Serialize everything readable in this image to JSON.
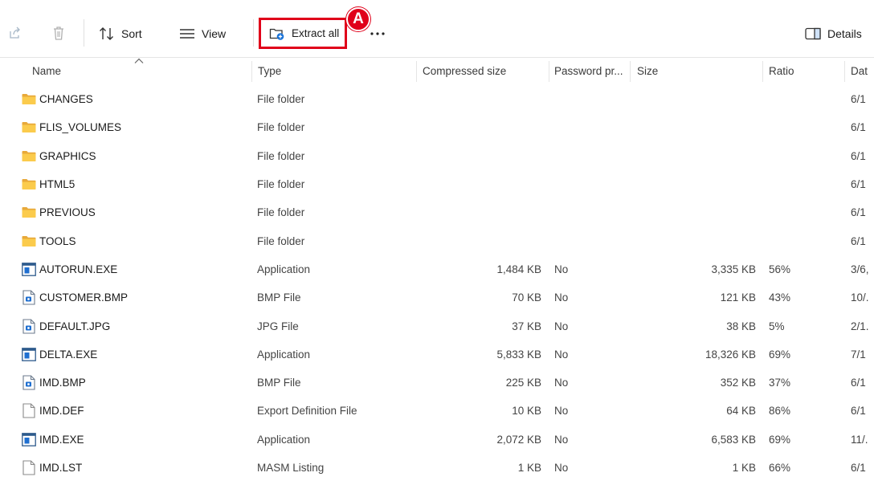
{
  "toolbar": {
    "share_icon": "share-icon",
    "delete_icon": "trash-icon",
    "sort_label": "Sort",
    "view_label": "View",
    "extract_label": "Extract all",
    "more_label": "…",
    "details_label": "Details",
    "marker_label": "A",
    "highlight_color": "#e0001a"
  },
  "columns": {
    "name": "Name",
    "type": "Type",
    "compressed": "Compressed size",
    "password": "Password pr...",
    "size": "Size",
    "ratio": "Ratio",
    "date": "Dat"
  },
  "rows": [
    {
      "icon": "folder-icon",
      "name": "CHANGES",
      "type": "File folder",
      "compressed": "",
      "password": "",
      "size": "",
      "ratio": "",
      "date": "6/1"
    },
    {
      "icon": "folder-icon",
      "name": "FLIS_VOLUMES",
      "type": "File folder",
      "compressed": "",
      "password": "",
      "size": "",
      "ratio": "",
      "date": "6/1"
    },
    {
      "icon": "folder-icon",
      "name": "GRAPHICS",
      "type": "File folder",
      "compressed": "",
      "password": "",
      "size": "",
      "ratio": "",
      "date": "6/1"
    },
    {
      "icon": "folder-icon",
      "name": "HTML5",
      "type": "File folder",
      "compressed": "",
      "password": "",
      "size": "",
      "ratio": "",
      "date": "6/1"
    },
    {
      "icon": "folder-icon",
      "name": "PREVIOUS",
      "type": "File folder",
      "compressed": "",
      "password": "",
      "size": "",
      "ratio": "",
      "date": "6/1"
    },
    {
      "icon": "folder-icon",
      "name": "TOOLS",
      "type": "File folder",
      "compressed": "",
      "password": "",
      "size": "",
      "ratio": "",
      "date": "6/1"
    },
    {
      "icon": "application-icon",
      "name": "AUTORUN.EXE",
      "type": "Application",
      "compressed": "1,484 KB",
      "password": "No",
      "size": "3,335 KB",
      "ratio": "56%",
      "date": "3/6,"
    },
    {
      "icon": "image-file-icon",
      "name": "CUSTOMER.BMP",
      "type": "BMP File",
      "compressed": "70 KB",
      "password": "No",
      "size": "121 KB",
      "ratio": "43%",
      "date": "10/."
    },
    {
      "icon": "image-file-icon",
      "name": "DEFAULT.JPG",
      "type": "JPG File",
      "compressed": "37 KB",
      "password": "No",
      "size": "38 KB",
      "ratio": "5%",
      "date": "2/1."
    },
    {
      "icon": "application-icon",
      "name": "DELTA.EXE",
      "type": "Application",
      "compressed": "5,833 KB",
      "password": "No",
      "size": "18,326 KB",
      "ratio": "69%",
      "date": "7/1"
    },
    {
      "icon": "image-file-icon",
      "name": "IMD.BMP",
      "type": "BMP File",
      "compressed": "225 KB",
      "password": "No",
      "size": "352 KB",
      "ratio": "37%",
      "date": "6/1"
    },
    {
      "icon": "blank-file-icon",
      "name": "IMD.DEF",
      "type": "Export Definition File",
      "compressed": "10 KB",
      "password": "No",
      "size": "64 KB",
      "ratio": "86%",
      "date": "6/1"
    },
    {
      "icon": "application-icon",
      "name": "IMD.EXE",
      "type": "Application",
      "compressed": "2,072 KB",
      "password": "No",
      "size": "6,583 KB",
      "ratio": "69%",
      "date": "11/."
    },
    {
      "icon": "blank-file-icon",
      "name": "IMD.LST",
      "type": "MASM Listing",
      "compressed": "1 KB",
      "password": "No",
      "size": "1 KB",
      "ratio": "66%",
      "date": "6/1"
    }
  ]
}
